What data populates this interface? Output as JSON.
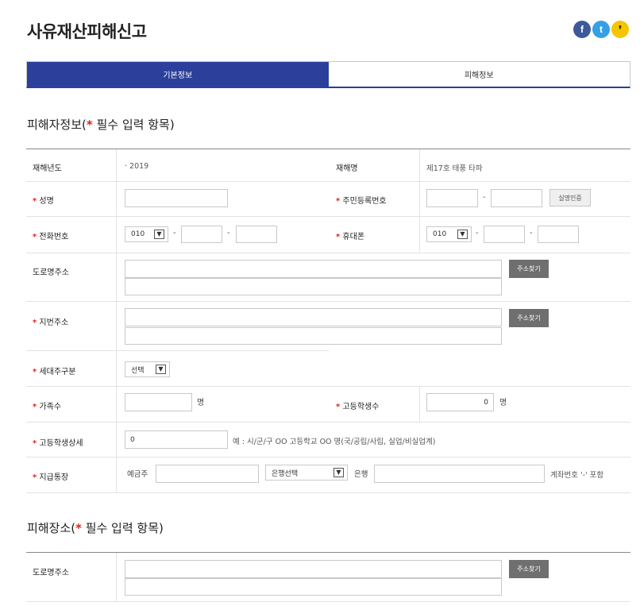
{
  "page": {
    "title": "사유재산피해신고"
  },
  "sns": [
    {
      "glyph": "f",
      "name": "facebook"
    },
    {
      "glyph": "t",
      "name": "twitter"
    },
    {
      "glyph": "❜",
      "name": "kakaostory"
    }
  ],
  "tabs": [
    {
      "label": "기본정보",
      "active": true
    },
    {
      "label": "피해정보",
      "active": false
    }
  ],
  "section1": {
    "title_prefix": "피해자정보(",
    "star": "*",
    "title_suffix": " 필수 입력 항목)"
  },
  "section2": {
    "title_prefix": "피해장소(",
    "star": "*",
    "title_suffix": " 필수 입력 항목)"
  },
  "common": {
    "star": "*",
    "dash": "-"
  },
  "form": {
    "disaster_year": {
      "label": "재해년도",
      "value": "· 2019"
    },
    "disaster_name": {
      "label": "재해명",
      "value": "제17호 태풍 타파"
    },
    "name": {
      "label": "성명",
      "value": ""
    },
    "resident_no": {
      "label": "주민등록번호",
      "part1": "",
      "part2": "",
      "verify_button": "실명인증"
    },
    "phone": {
      "label": "전화번호",
      "prefix": "010",
      "mid": "",
      "last": ""
    },
    "mobile": {
      "label": "휴대폰",
      "prefix": "010",
      "mid": "",
      "last": ""
    },
    "road_address": {
      "label": "도로명주소",
      "line1": "",
      "line2": "",
      "search_button": "주소찾기"
    },
    "lot_address": {
      "label": "지번주소",
      "line1": "",
      "line2": "",
      "search_button": "주소찾기"
    },
    "householder": {
      "label": "세대주구분",
      "selected": "선택"
    },
    "family_count": {
      "label": "가족수",
      "value": "",
      "unit": "명"
    },
    "highschool_count": {
      "label": "고등학생수",
      "value": "0",
      "unit": "명"
    },
    "highschool_detail": {
      "label": "고등학생상세",
      "value": "0",
      "note": "예 : 시/군/구 OO 고등학교 OO 명(국/공립/사립, 실업/비실업계)"
    },
    "bank_account": {
      "label": "지급통장",
      "holder_label": "예금주",
      "holder": "",
      "bank_selected": "은행선택",
      "bank_label": "은행",
      "account": "",
      "note": "계좌번호 '-' 포함"
    }
  },
  "place": {
    "road_address": {
      "label": "도로명주소",
      "line1": "",
      "line2": "",
      "search_button": "주소찾기"
    }
  }
}
